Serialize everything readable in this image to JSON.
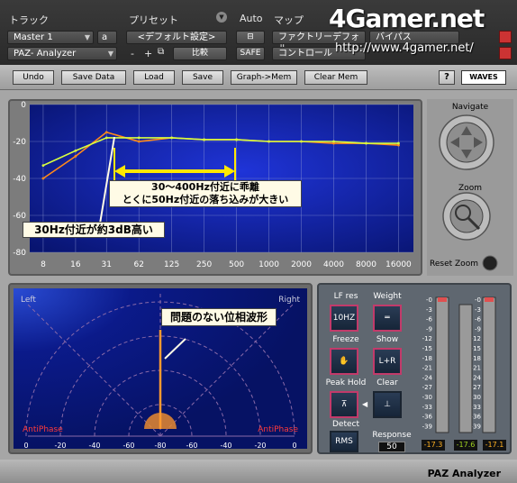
{
  "host": {
    "track_label": "トラック",
    "preset_label": "プリセット",
    "auto_label": "Auto",
    "map_label": "マップ",
    "track_value": "Master 1",
    "track_slot": "a",
    "plugin_value": "PAZ- Analyzer",
    "preset_value": "<デフォルト設定>",
    "minus": "-",
    "plus": "+",
    "compare": "比較",
    "safe": "SAFE",
    "map_value": "ファクトリーデフォル",
    "bypass": "バイパス",
    "control": "コントロール",
    "watermark_logo": "4Gamer.net",
    "watermark_url": "http://www.4gamer.net/"
  },
  "toolbar": {
    "undo": "Undo",
    "save_data": "Save Data",
    "load": "Load",
    "save": "Save",
    "graph_mem": "Graph->Mem",
    "clear_mem": "Clear Mem",
    "help": "?",
    "logo": "WAVES"
  },
  "spectrum": {
    "y_ticks": [
      "0",
      "-20",
      "-40",
      "-60",
      "-80"
    ],
    "x_ticks": [
      "8",
      "16",
      "31",
      "62",
      "125",
      "250",
      "500",
      "1000",
      "2000",
      "4000",
      "8000",
      "16000"
    ]
  },
  "navigate": {
    "navigate_label": "Navigate",
    "zoom_label": "Zoom",
    "reset_zoom_label": "Reset Zoom"
  },
  "phase": {
    "left": "Left",
    "right": "Right",
    "anti_left": "AntiPhase",
    "anti_right": "AntiPhase",
    "x_ticks": [
      "0",
      "-20",
      "-40",
      "-60",
      "-80",
      "-60",
      "-40",
      "-20",
      "0"
    ]
  },
  "controls": {
    "lf_res_label": "LF res",
    "lf_res_value": "10HZ",
    "weight_label": "Weight",
    "freeze_label": "Freeze",
    "show_label": "Show",
    "show_value": "L+R",
    "peak_hold_label": "Peak Hold",
    "clear_label": "Clear",
    "detect_label": "Detect",
    "detect_value": "RMS",
    "response_label": "Response",
    "response_value": "50",
    "meter_scale": [
      "-0",
      "-3",
      "-6",
      "-9",
      "-12",
      "-15",
      "-18",
      "-21",
      "-24",
      "-27",
      "-30",
      "-33",
      "-36",
      "-39"
    ],
    "meter_left_value": "-17.3",
    "meter_center_value": "-17.6",
    "meter_right_value": "-17.1"
  },
  "status": {
    "name": "PAZ Analyzer"
  },
  "annotations": {
    "a1_line1": "30～400Hz付近に乖離",
    "a1_line2": "とくに50Hz付近の落ち込みが大きい",
    "a2": "30Hz付近が約3dB高い",
    "a3": "問題のない位相波形"
  },
  "chart_data": {
    "type": "line",
    "x_scale": "log",
    "xlabel": "",
    "ylabel": "",
    "ylim": [
      -80,
      0
    ],
    "x": [
      8,
      16,
      31,
      62,
      125,
      250,
      500,
      1000,
      2000,
      4000,
      8000,
      16000
    ],
    "series": [
      {
        "color": "#ff8a1a",
        "values": [
          -40,
          -28,
          -15,
          -20,
          -18,
          -19,
          -19,
          -20,
          -20,
          -21,
          -21,
          -22
        ]
      },
      {
        "color": "#d8ff40",
        "values": [
          -33,
          -25,
          -18,
          -18,
          -18,
          -19,
          -19,
          -20,
          -20,
          -20,
          -21,
          -21
        ]
      }
    ],
    "grid": true,
    "colors": {
      "background": "#0a1aa0",
      "grid": "#9aa4d8"
    }
  }
}
